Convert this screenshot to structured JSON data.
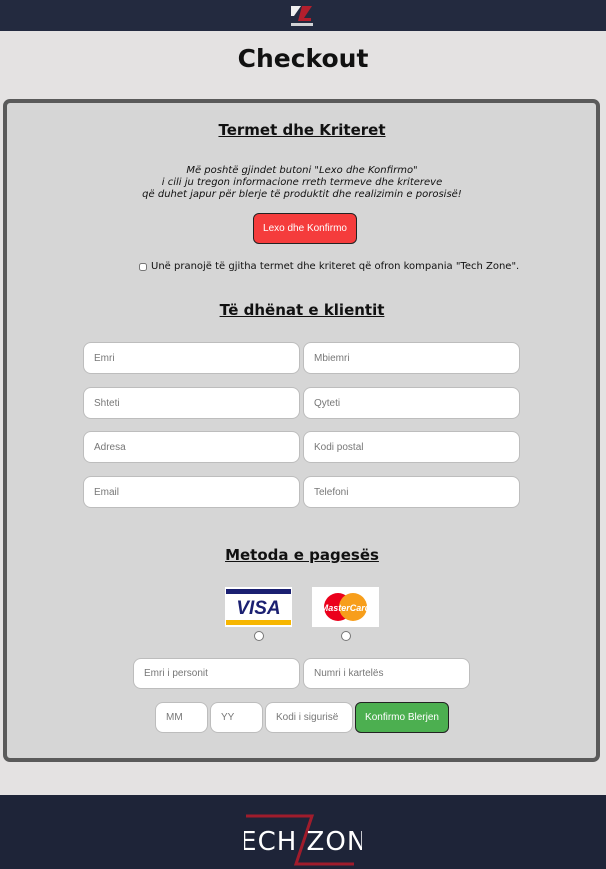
{
  "header": {
    "logo_icon": "techzone-small-logo-icon"
  },
  "page_title": "Checkout",
  "terms": {
    "title": "Termet dhe Kriteret",
    "line1": "Më poshtë gjindet butoni \"Lexo dhe Konfirmo\"",
    "line2": "i cili ju tregon informacione rreth termeve dhe kritereve",
    "line3": "që duhet japur për blerje të produktit dhe realizimin e porosisë!",
    "read_button": "Lexo dhe Konfirmo",
    "agree_label": "Unë pranojë të gjitha termet dhe kriteret që ofron kompania \"Tech Zone\"."
  },
  "client": {
    "title": "Të dhënat e klientit",
    "first_name_placeholder": "Emri",
    "last_name_placeholder": "Mbiemri",
    "country_placeholder": "Shteti",
    "city_placeholder": "Qyteti",
    "address_placeholder": "Adresa",
    "postal_placeholder": "Kodi postal",
    "email_placeholder": "Email",
    "phone_placeholder": "Telefoni"
  },
  "payment": {
    "title": "Metoda e pagesës",
    "visa_text": "VISA",
    "mastercard_text": "MasterCard",
    "cardholder_placeholder": "Emri i personit",
    "card_number_placeholder": "Numri i kartelës",
    "month_placeholder": "MM",
    "year_placeholder": "YY",
    "security_placeholder": "Kodi i sigurisë",
    "confirm_button": "Konfirmo Blerjen"
  },
  "footer": {
    "logo_icon": "techzone-logo-icon",
    "logo_text": "TECH ZONE"
  },
  "colors": {
    "topbar": "#232a3f",
    "footer": "#1e2438",
    "read_button": "#f53c3c",
    "confirm_button": "#4caf50",
    "brand_red": "#a01c2c",
    "visa_blue": "#1a1f71",
    "visa_gold": "#f7b600"
  }
}
